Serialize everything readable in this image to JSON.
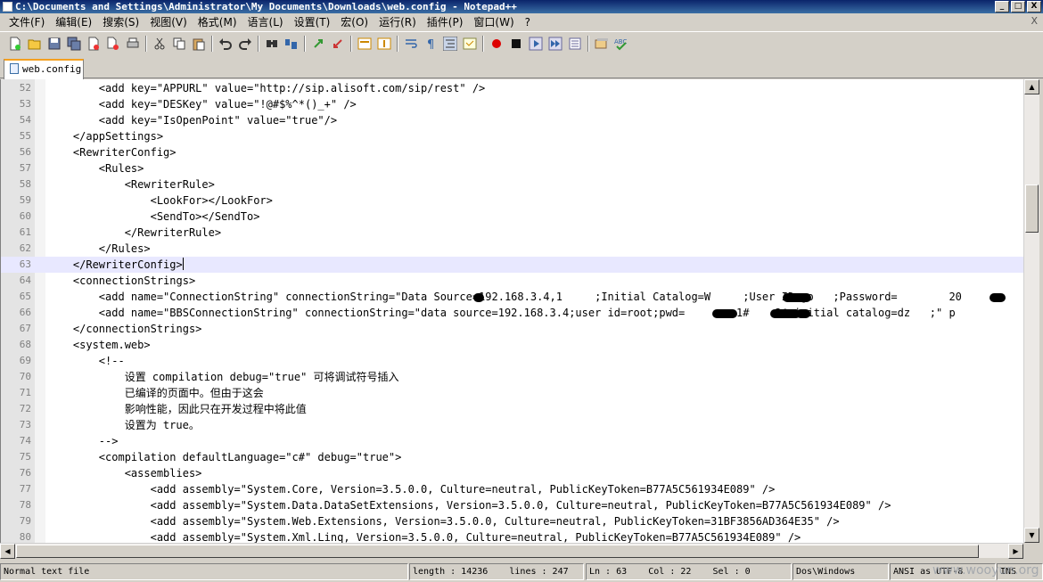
{
  "window": {
    "title": "C:\\Documents and Settings\\Administrator\\My Documents\\Downloads\\web.config - Notepad++",
    "btn_min": "_",
    "btn_max": "□",
    "btn_close": "X"
  },
  "menu": {
    "items": [
      "文件(F)",
      "编辑(E)",
      "搜索(S)",
      "视图(V)",
      "格式(M)",
      "语言(L)",
      "设置(T)",
      "宏(O)",
      "运行(R)",
      "插件(P)",
      "窗口(W)",
      "?"
    ],
    "close_x": "X"
  },
  "toolbar": {
    "icons": [
      "new-file-icon",
      "open-file-icon",
      "save-icon",
      "save-all-icon",
      "close-icon",
      "close-all-icon",
      "print-icon",
      "cut-icon",
      "copy-icon",
      "paste-icon",
      "undo-icon",
      "redo-icon",
      "find-icon",
      "replace-icon",
      "zoom-in-icon",
      "zoom-out-icon",
      "sync-v-icon",
      "sync-h-icon",
      "word-wrap-icon",
      "show-all-chars-icon",
      "indent-guide-icon",
      "udl-icon",
      "record-macro-icon",
      "stop-record-icon",
      "play-macro-icon",
      "run-macro-multiple-icon",
      "save-macro-icon",
      "translate-icon",
      "spell-check-icon"
    ]
  },
  "tab": {
    "label": "web.config"
  },
  "editor": {
    "lines": [
      {
        "n": "52",
        "text": "        <add key=\"APPURL\" value=\"http://sip.alisoft.com/sip/rest\" />"
      },
      {
        "n": "53",
        "text": "        <add key=\"DESKey\" value=\"!@#$%^*()_+\" />"
      },
      {
        "n": "54",
        "text": "        <add key=\"IsOpenPoint\" value=\"true\"/>"
      },
      {
        "n": "55",
        "text": "    </appSettings>"
      },
      {
        "n": "56",
        "text": "    <RewriterConfig>"
      },
      {
        "n": "57",
        "text": "        <Rules>"
      },
      {
        "n": "58",
        "text": "            <RewriterRule>"
      },
      {
        "n": "59",
        "text": "                <LookFor></LookFor>"
      },
      {
        "n": "60",
        "text": "                <SendTo></SendTo>"
      },
      {
        "n": "61",
        "text": "            </RewriterRule>"
      },
      {
        "n": "62",
        "text": "        </Rules>"
      },
      {
        "n": "63",
        "text": "    </RewriterConfig>"
      },
      {
        "n": "64",
        "text": "    <connectionStrings>"
      },
      {
        "n": "65",
        "text": "        <add name=\"ConnectionString\" connectionString=\"Data Source=192.168.3.4,1     ;Initial Catalog=W     ;User ID=go   ;Password=        20"
      },
      {
        "n": "66",
        "text": "        <add name=\"BBSConnectionString\" connectionString=\"data source=192.168.3.4;user id=root;pwd=        1#    2@;initial catalog=dz   ;\" p"
      },
      {
        "n": "67",
        "text": "    </connectionStrings>"
      },
      {
        "n": "68",
        "text": "    <system.web>"
      },
      {
        "n": "69",
        "text": "        <!--"
      },
      {
        "n": "70",
        "text": "            设置 compilation debug=\"true\" 可将调试符号插入"
      },
      {
        "n": "71",
        "text": "            已编译的页面中。但由于这会"
      },
      {
        "n": "72",
        "text": "            影响性能，因此只在开发过程中将此值"
      },
      {
        "n": "73",
        "text": "            设置为 true。"
      },
      {
        "n": "74",
        "text": "        -->"
      },
      {
        "n": "75",
        "text": "        <compilation defaultLanguage=\"c#\" debug=\"true\">"
      },
      {
        "n": "76",
        "text": "            <assemblies>"
      },
      {
        "n": "77",
        "text": "                <add assembly=\"System.Core, Version=3.5.0.0, Culture=neutral, PublicKeyToken=B77A5C561934E089\" />"
      },
      {
        "n": "78",
        "text": "                <add assembly=\"System.Data.DataSetExtensions, Version=3.5.0.0, Culture=neutral, PublicKeyToken=B77A5C561934E089\" />"
      },
      {
        "n": "79",
        "text": "                <add assembly=\"System.Web.Extensions, Version=3.5.0.0, Culture=neutral, PublicKeyToken=31BF3856AD364E35\" />"
      },
      {
        "n": "80",
        "text": "                <add assembly=\"System.Xml.Linq, Version=3.5.0.0, Culture=neutral, PublicKeyToken=B77A5C561934E089\" />"
      }
    ],
    "current_line": "63"
  },
  "status": {
    "file_type": "Normal text file",
    "length": "length : 14236",
    "lines": "lines : 247",
    "ln": "Ln : 63",
    "col": "Col : 22",
    "sel": "Sel : 0",
    "eol": "Dos\\Windows",
    "encoding": "ANSI as UTF-8",
    "mode": "INS"
  },
  "watermark": "www.wooyun.org",
  "colors": {
    "title_bg": "#0a246a",
    "current_line_bg": "#e8e8ff",
    "tab_accent": "#f4a020"
  }
}
